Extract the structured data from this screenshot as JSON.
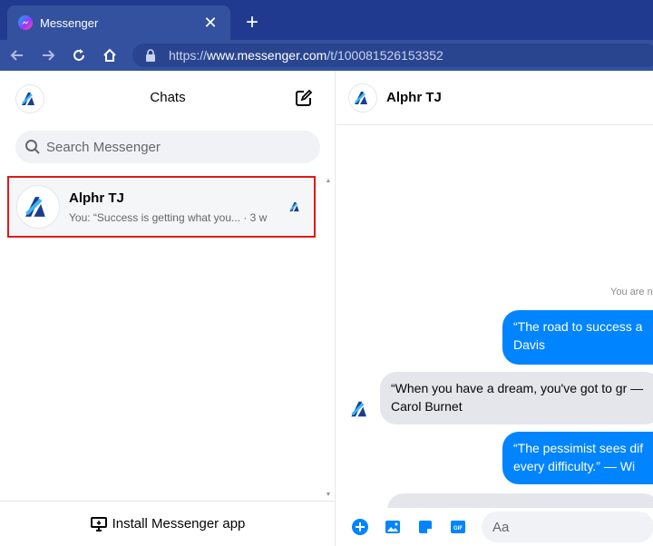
{
  "browser": {
    "tab_title": "Messenger",
    "close_glyph": "✕",
    "newtab_glyph": "+",
    "url_prefix": "https://",
    "url_host": "www.messenger.com",
    "url_path": "/t/100081526153352"
  },
  "sidebar": {
    "title": "Chats",
    "search_placeholder": "Search Messenger",
    "chats": [
      {
        "name": "Alphr TJ",
        "preview": "You: “Success is getting what you... · 3 w"
      }
    ],
    "install_label": "Install Messenger app"
  },
  "conversation": {
    "name": "Alphr TJ",
    "status_text": "You are n",
    "messages": [
      {
        "direction": "out",
        "text": "“The road to success a Davis"
      },
      {
        "direction": "in",
        "text": "“When you have a dream, you've got to gr — Carol Burnet"
      },
      {
        "direction": "out",
        "text": "“The pessimist sees dif every difficulty.” — Wi"
      }
    ],
    "composer_placeholder": "Aa"
  },
  "colors": {
    "chrome_dark": "#1f3a8f",
    "chrome": "#34519f",
    "accent": "#0084ff",
    "highlight_border": "#e01919"
  }
}
